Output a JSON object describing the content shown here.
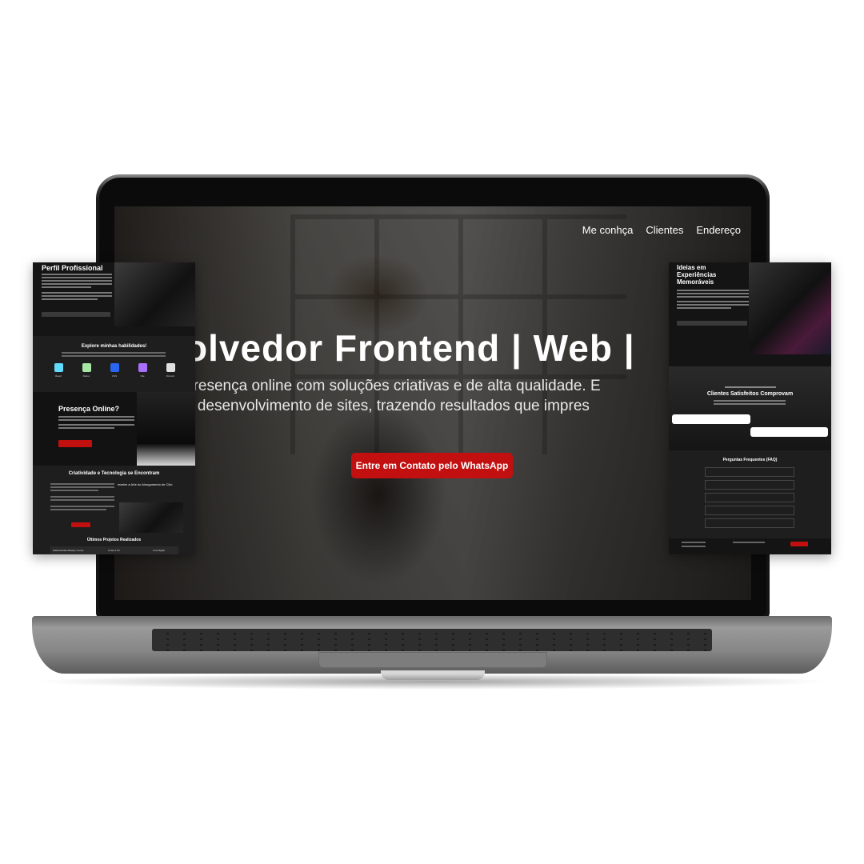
{
  "nav": {
    "items": [
      "Me conhça",
      "Clientes",
      "Endereço"
    ]
  },
  "hero": {
    "title": "olvedor Frontend | Web | ",
    "subtitle_lines": [
      "presença online com soluções criativas e de alta qualidade. E",
      "e desenvolvimento de sites, trazendo resultados que impres"
    ],
    "cta_label": "Entre em Contato pelo WhatsApp"
  },
  "left_card": {
    "profile_title": "Perfil Profissional",
    "skills_title": "Explore minhas habilidades!",
    "skills": [
      {
        "label": "React",
        "color": "#61dafb"
      },
      {
        "label": "Redux",
        "color": "#a8e6a3"
      },
      {
        "label": "CSS",
        "color": "#2965f1"
      },
      {
        "label": "Vite",
        "color": "#a970ff"
      },
      {
        "label": "Discord",
        "color": "#e0e0e0"
      }
    ],
    "presence_title": "Presença Online?",
    "creativity_title": "Criatividade e Tecnologia se Encontram",
    "article_title": "mestre a Arte do Alongamento de Cílio",
    "projects_title": "Últimos Projetos Realizados",
    "projects": [
      "Gildia Estúdio Beauty Center",
      "Costa 1.33",
      "Ia la Digital"
    ]
  },
  "right_card": {
    "ideas_title_lines": [
      "Ideias em",
      "Experiências",
      "Memoráveis"
    ],
    "clients_title": "Clientes Satisfeitos Comprovam",
    "faq_title": "Perguntas Frequentes (FAQ)",
    "faq_count": 5
  },
  "colors": {
    "accent": "#c20f0f",
    "card_bg": "#1b1b1b"
  }
}
